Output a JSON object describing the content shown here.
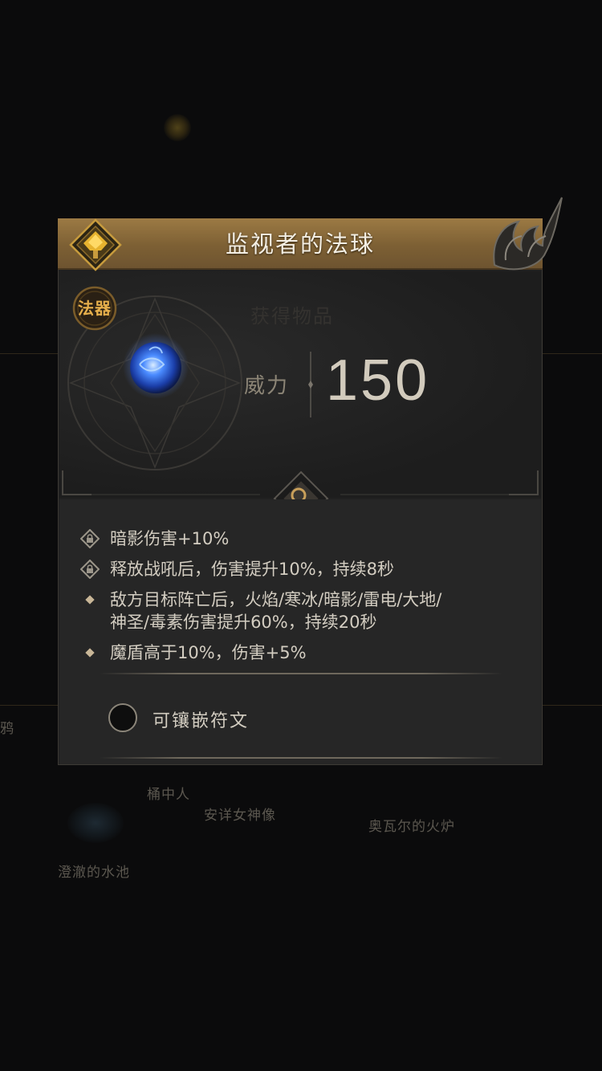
{
  "item": {
    "name": "监视者的法球",
    "category": "法器",
    "watermark": "获得物品",
    "stat_label": "威力",
    "stat_value": "150"
  },
  "affixes": [
    {
      "icon": "locked-affix-icon",
      "text": "暗影伤害+10%"
    },
    {
      "icon": "locked-affix-icon",
      "text": "释放战吼后，伤害提升10%，持续8秒"
    },
    {
      "icon": "diamond-bullet-icon",
      "text": "敌方目标阵亡后，火焰/寒冰/暗影/雷电/大地/"
    },
    {
      "icon": "none",
      "text": "神圣/毒素伤害提升60%，持续20秒"
    },
    {
      "icon": "diamond-bullet-icon",
      "text": "魔盾高于10%，伤害+5%"
    }
  ],
  "socket": {
    "label": "可镶嵌符文",
    "state": "empty"
  },
  "background_map": {
    "labels": [
      "桶中人",
      "安详女神像",
      "奥瓦尔的火炉",
      "澄澈的水池",
      "鸦"
    ]
  },
  "colors": {
    "title_bar": "#8a6a3a",
    "category_text": "#e7b04c",
    "panel": "#202020",
    "lower_panel": "#262626",
    "orb": "#4a8bff"
  }
}
